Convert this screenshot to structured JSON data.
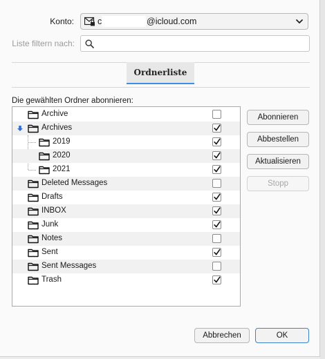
{
  "account": {
    "label": "Konto:",
    "value": "@icloud.com",
    "value_prefix": "c"
  },
  "filter": {
    "label": "Liste filtern nach:",
    "placeholder": ""
  },
  "tabs": [
    {
      "label": "Ordnerliste",
      "active": true
    }
  ],
  "folders_heading": "Die gewählten Ordner abonnieren:",
  "folders": [
    {
      "name": "Archive",
      "level": 0,
      "subscribed": false,
      "expanded": null
    },
    {
      "name": "Archives",
      "level": 0,
      "subscribed": true,
      "expanded": true
    },
    {
      "name": "2019",
      "level": 1,
      "subscribed": true,
      "expanded": null
    },
    {
      "name": "2020",
      "level": 1,
      "subscribed": true,
      "expanded": null
    },
    {
      "name": "2021",
      "level": 1,
      "subscribed": true,
      "expanded": null
    },
    {
      "name": "Deleted Messages",
      "level": 0,
      "subscribed": false,
      "expanded": null
    },
    {
      "name": "Drafts",
      "level": 0,
      "subscribed": true,
      "expanded": null
    },
    {
      "name": "INBOX",
      "level": 0,
      "subscribed": true,
      "expanded": null
    },
    {
      "name": "Junk",
      "level": 0,
      "subscribed": true,
      "expanded": null
    },
    {
      "name": "Notes",
      "level": 0,
      "subscribed": false,
      "expanded": null
    },
    {
      "name": "Sent",
      "level": 0,
      "subscribed": true,
      "expanded": null
    },
    {
      "name": "Sent Messages",
      "level": 0,
      "subscribed": false,
      "expanded": null
    },
    {
      "name": "Trash",
      "level": 0,
      "subscribed": true,
      "expanded": null
    }
  ],
  "actions": {
    "subscribe": "Abonnieren",
    "unsubscribe": "Abbestellen",
    "refresh": "Aktualisieren",
    "stop": "Stopp"
  },
  "footer": {
    "cancel": "Abbrechen",
    "ok": "OK"
  },
  "colors": {
    "accent": "#3c8fe0",
    "twisty": "#2f6fd0"
  },
  "icons": {
    "account": "mail-lock-icon",
    "search": "search-icon",
    "dropdown": "chevron-down-icon",
    "folder": "folder-icon",
    "expand": "expand-arrow-icon",
    "check": "checkmark-icon"
  }
}
